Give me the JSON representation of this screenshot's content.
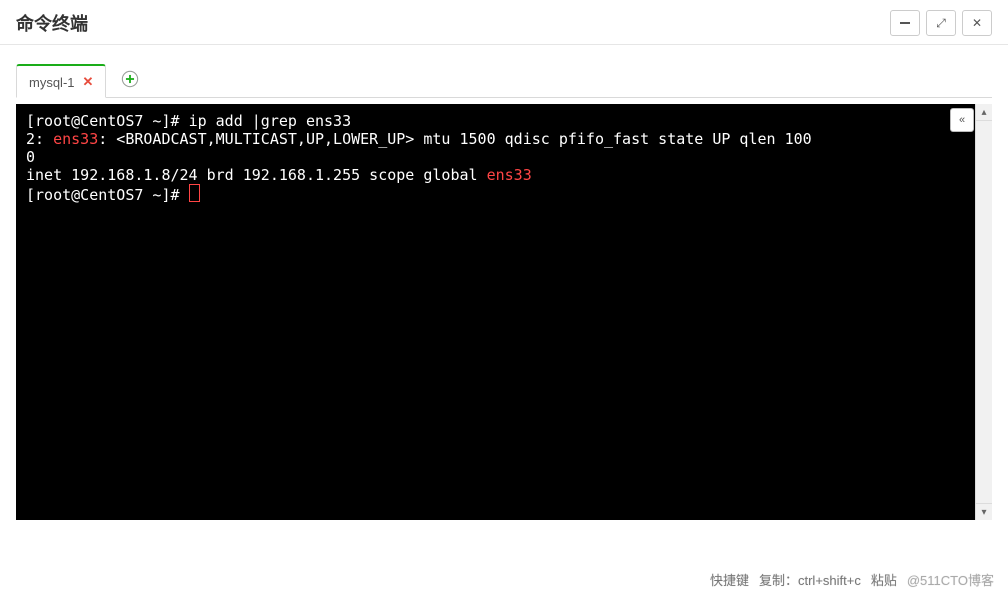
{
  "window": {
    "title": "命令终端"
  },
  "tabs": {
    "items": [
      {
        "label": "mysql-1"
      }
    ]
  },
  "terminal": {
    "lines": {
      "prompt1": "[root@CentOS7 ~]# ",
      "cmd1": "ip add |grep ens33",
      "l2a": "2: ",
      "l2b": "ens33",
      "l2c": ": <BROADCAST,MULTICAST,UP,LOWER_UP> mtu 1500 qdisc pfifo_fast state UP qlen 100",
      "l3": "0",
      "l4a": "    inet 192.168.1.8/24 brd 192.168.1.255 scope global ",
      "l4b": "ens33",
      "prompt2": "[root@CentOS7 ~]# "
    }
  },
  "footer": {
    "shortcut_label": "快捷键",
    "copy_label": "复制：ctrl+shift+c",
    "paste_label": "粘贴",
    "watermark": "@511CTO博客"
  }
}
